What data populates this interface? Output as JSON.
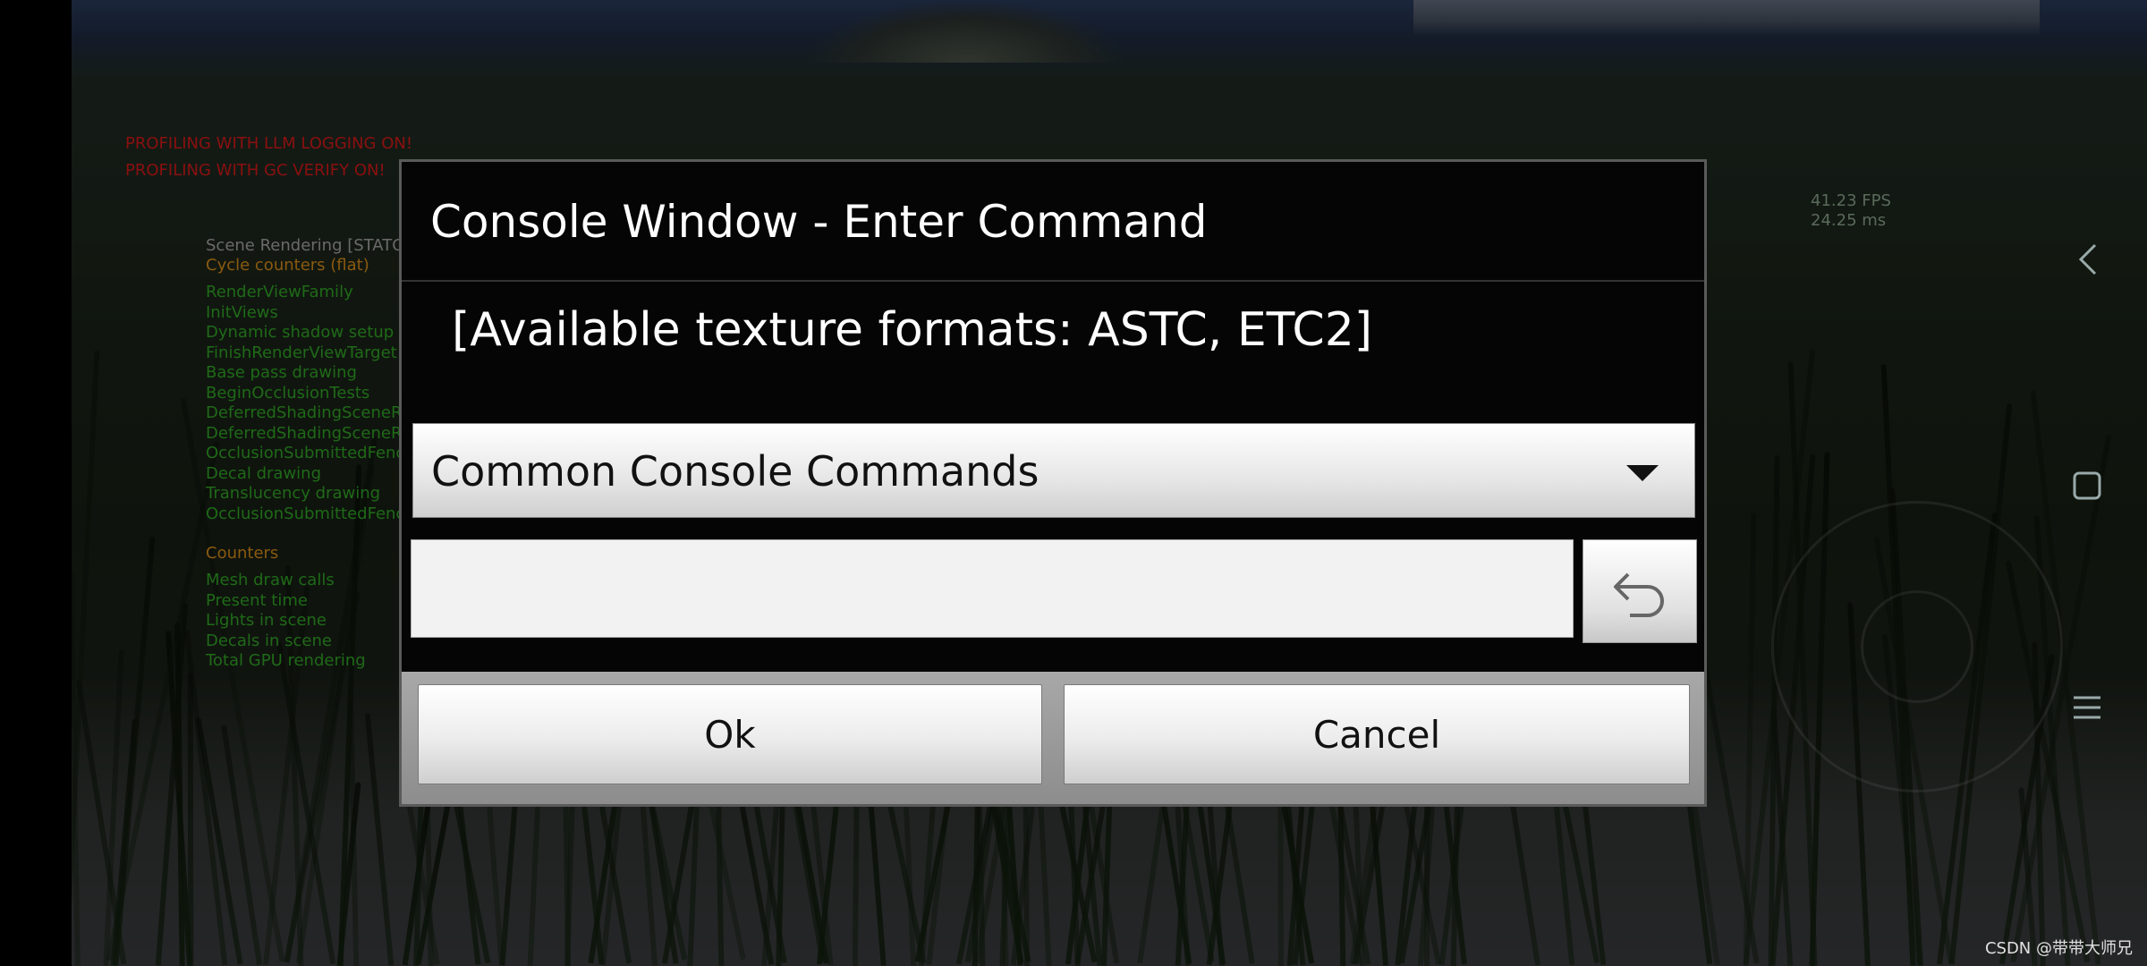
{
  "debug_overlay": {
    "warnings": [
      "PROFILING WITH LLM LOGGING ON!",
      "PROFILING WITH GC VERIFY ON!"
    ],
    "stats_header": "Scene Rendering [STATGROUP]",
    "cycle_counters_label": "Cycle counters (flat)",
    "cycle_counters": [
      "RenderViewFamily",
      "InitViews",
      "Dynamic shadow setup",
      "FinishRenderViewTarget",
      "Base pass drawing",
      "BeginOcclusionTests",
      "DeferredShadingSceneR",
      "DeferredShadingSceneR",
      "OcclusionSubmittedFenc",
      "Decal drawing",
      "Translucency drawing",
      "OcclusionSubmittedFenc"
    ],
    "counters_label": "Counters",
    "counters": [
      "Mesh draw calls",
      "Present time",
      "Lights in scene",
      "Decals in scene",
      "Total GPU rendering"
    ],
    "fps": "41.23 FPS",
    "frame_ms": "24.25 ms"
  },
  "dialog": {
    "title": "Console Window - Enter Command",
    "message": "[Available texture formats: ASTC, ETC2]",
    "dropdown_selected": "Common Console Commands",
    "input_value": "",
    "input_placeholder": "",
    "ok_label": "Ok",
    "cancel_label": "Cancel"
  },
  "nav_icons": [
    "back-icon",
    "home-square-icon",
    "menu-icon"
  ],
  "watermark": "CSDN @带带大师兄",
  "colors": {
    "warning_red": "#8a1010",
    "counter_green": "#1f6a18",
    "label_orange": "#8a5a10"
  }
}
